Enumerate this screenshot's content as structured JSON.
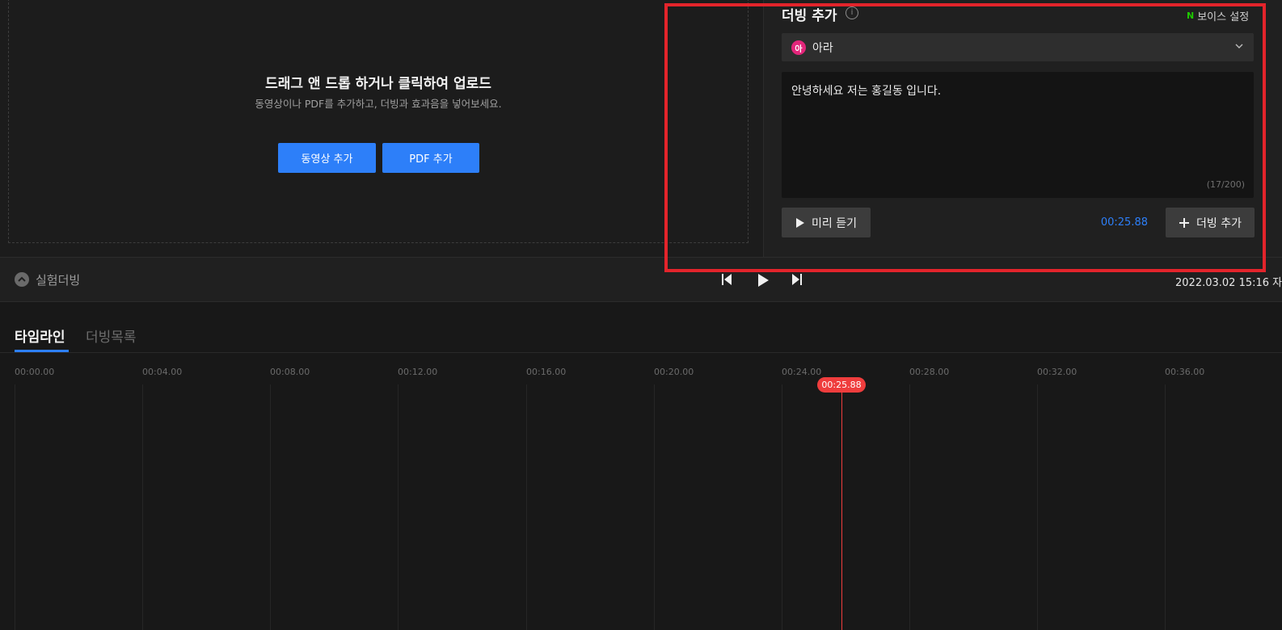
{
  "upload": {
    "title": "드래그 앤 드롭 하거나 클릭하여 업로드",
    "subtitle": "동영상이나 PDF를 추가하고, 더빙과 효과음을 넣어보세요.",
    "add_video_label": "동영상 추가",
    "add_pdf_label": "PDF 추가"
  },
  "dubbing": {
    "title": "더빙 추가",
    "info_icon": "i",
    "voice_settings_badge": "N",
    "voice_settings_label": "보이스 설정",
    "voice": {
      "avatar_text": "아",
      "name": "아라",
      "avatar_color": "#e3267b"
    },
    "script_text": "안녕하세요 저는 홍길동 입니다.",
    "char_count": "(17/200)",
    "preview_label": "미리 듣기",
    "timecode": "00:25.88",
    "add_label": "더빙 추가"
  },
  "transport": {
    "collapse_label": "실험더빙",
    "datetime": "2022.03.02 15:16 자"
  },
  "tabs": {
    "timeline": "타임라인",
    "dub_list": "더빙목록"
  },
  "timeline": {
    "ticks": [
      "00:00.00",
      "00:04.00",
      "00:08.00",
      "00:12.00",
      "00:16.00",
      "00:20.00",
      "00:24.00",
      "00:28.00",
      "00:32.00",
      "00:36.00"
    ],
    "playhead": "00:25.88"
  },
  "colors": {
    "accent": "#2d7ff9",
    "playhead": "#ef3d3d",
    "highlight": "#e3242b",
    "naver_green": "#1ec800"
  }
}
